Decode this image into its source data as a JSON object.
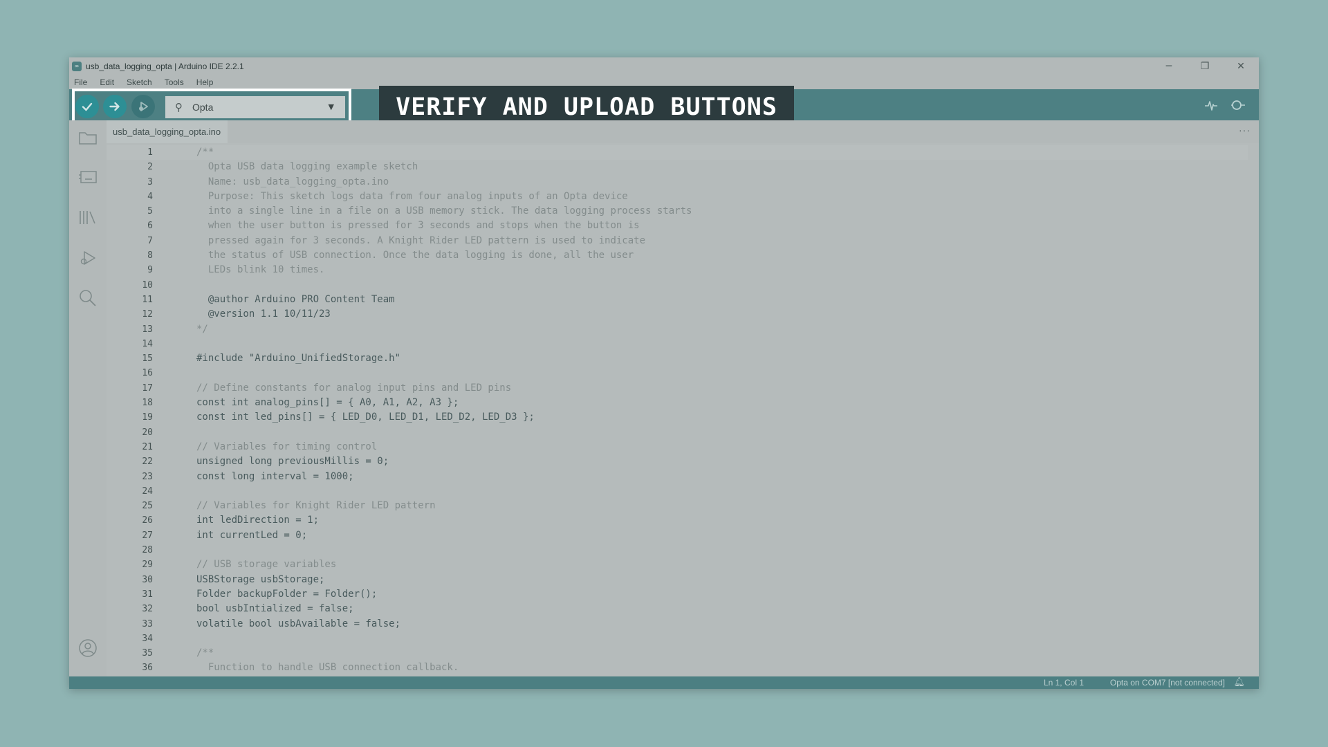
{
  "window": {
    "title": "usb_data_logging_opta | Arduino IDE 2.2.1",
    "controls": {
      "minimize": "─",
      "restore": "❐",
      "close": "✕"
    }
  },
  "menu": [
    "File",
    "Edit",
    "Sketch",
    "Tools",
    "Help"
  ],
  "toolbar": {
    "board": "Opta",
    "verify_icon": "check-icon",
    "upload_icon": "arrow-right-icon",
    "debug_icon": "debug-icon",
    "serial_plotter_icon": "pulse-icon",
    "serial_monitor_icon": "magnifier-icon"
  },
  "banner": {
    "text": "VERIFY AND UPLOAD BUTTONS"
  },
  "sidebar_icons": [
    "folder-icon",
    "board-icon",
    "library-icon",
    "debug-icon",
    "search-icon",
    "account-icon"
  ],
  "tab": {
    "label": "usb_data_logging_opta.ino",
    "more": "···"
  },
  "editor": {
    "lines": [
      {
        "n": "1",
        "t": "/**",
        "c": true
      },
      {
        "n": "2",
        "t": "  Opta USB data logging example sketch",
        "c": true
      },
      {
        "n": "3",
        "t": "  Name: usb_data_logging_opta.ino",
        "c": true
      },
      {
        "n": "4",
        "t": "  Purpose: This sketch logs data from four analog inputs of an Opta device",
        "c": true
      },
      {
        "n": "5",
        "t": "  into a single line in a file on a USB memory stick. The data logging process starts",
        "c": true
      },
      {
        "n": "6",
        "t": "  when the user button is pressed for 3 seconds and stops when the button is",
        "c": true
      },
      {
        "n": "7",
        "t": "  pressed again for 3 seconds. A Knight Rider LED pattern is used to indicate",
        "c": true
      },
      {
        "n": "8",
        "t": "  the status of USB connection. Once the data logging is done, all the user",
        "c": true
      },
      {
        "n": "9",
        "t": "  LEDs blink 10 times.",
        "c": true
      },
      {
        "n": "10",
        "t": "",
        "c": true
      },
      {
        "n": "11",
        "t": "  @author Arduino PRO Content Team",
        "c": false
      },
      {
        "n": "12",
        "t": "  @version 1.1 10/11/23",
        "c": false
      },
      {
        "n": "13",
        "t": "*/",
        "c": true
      },
      {
        "n": "14",
        "t": "",
        "c": false
      },
      {
        "n": "15",
        "t": "#include \"Arduino_UnifiedStorage.h\"",
        "c": false
      },
      {
        "n": "16",
        "t": "",
        "c": false
      },
      {
        "n": "17",
        "t": "// Define constants for analog input pins and LED pins",
        "c": true
      },
      {
        "n": "18",
        "t": "const int analog_pins[] = { A0, A1, A2, A3 };",
        "c": false
      },
      {
        "n": "19",
        "t": "const int led_pins[] = { LED_D0, LED_D1, LED_D2, LED_D3 };",
        "c": false
      },
      {
        "n": "20",
        "t": "",
        "c": false
      },
      {
        "n": "21",
        "t": "// Variables for timing control",
        "c": true
      },
      {
        "n": "22",
        "t": "unsigned long previousMillis = 0;",
        "c": false
      },
      {
        "n": "23",
        "t": "const long interval = 1000;",
        "c": false
      },
      {
        "n": "24",
        "t": "",
        "c": false
      },
      {
        "n": "25",
        "t": "// Variables for Knight Rider LED pattern",
        "c": true
      },
      {
        "n": "26",
        "t": "int ledDirection = 1;",
        "c": false
      },
      {
        "n": "27",
        "t": "int currentLed = 0;",
        "c": false
      },
      {
        "n": "28",
        "t": "",
        "c": false
      },
      {
        "n": "29",
        "t": "// USB storage variables",
        "c": true
      },
      {
        "n": "30",
        "t": "USBStorage usbStorage;",
        "c": false
      },
      {
        "n": "31",
        "t": "Folder backupFolder = Folder();",
        "c": false
      },
      {
        "n": "32",
        "t": "bool usbIntialized = false;",
        "c": false
      },
      {
        "n": "33",
        "t": "volatile bool usbAvailable = false;",
        "c": false
      },
      {
        "n": "34",
        "t": "",
        "c": false
      },
      {
        "n": "35",
        "t": "/**",
        "c": true
      },
      {
        "n": "36",
        "t": "  Function to handle USB connection callback.",
        "c": true
      }
    ]
  },
  "status": {
    "position": "Ln 1, Col 1",
    "board": "Opta on COM7 [not connected]",
    "bell_icon": "bell-icon"
  }
}
